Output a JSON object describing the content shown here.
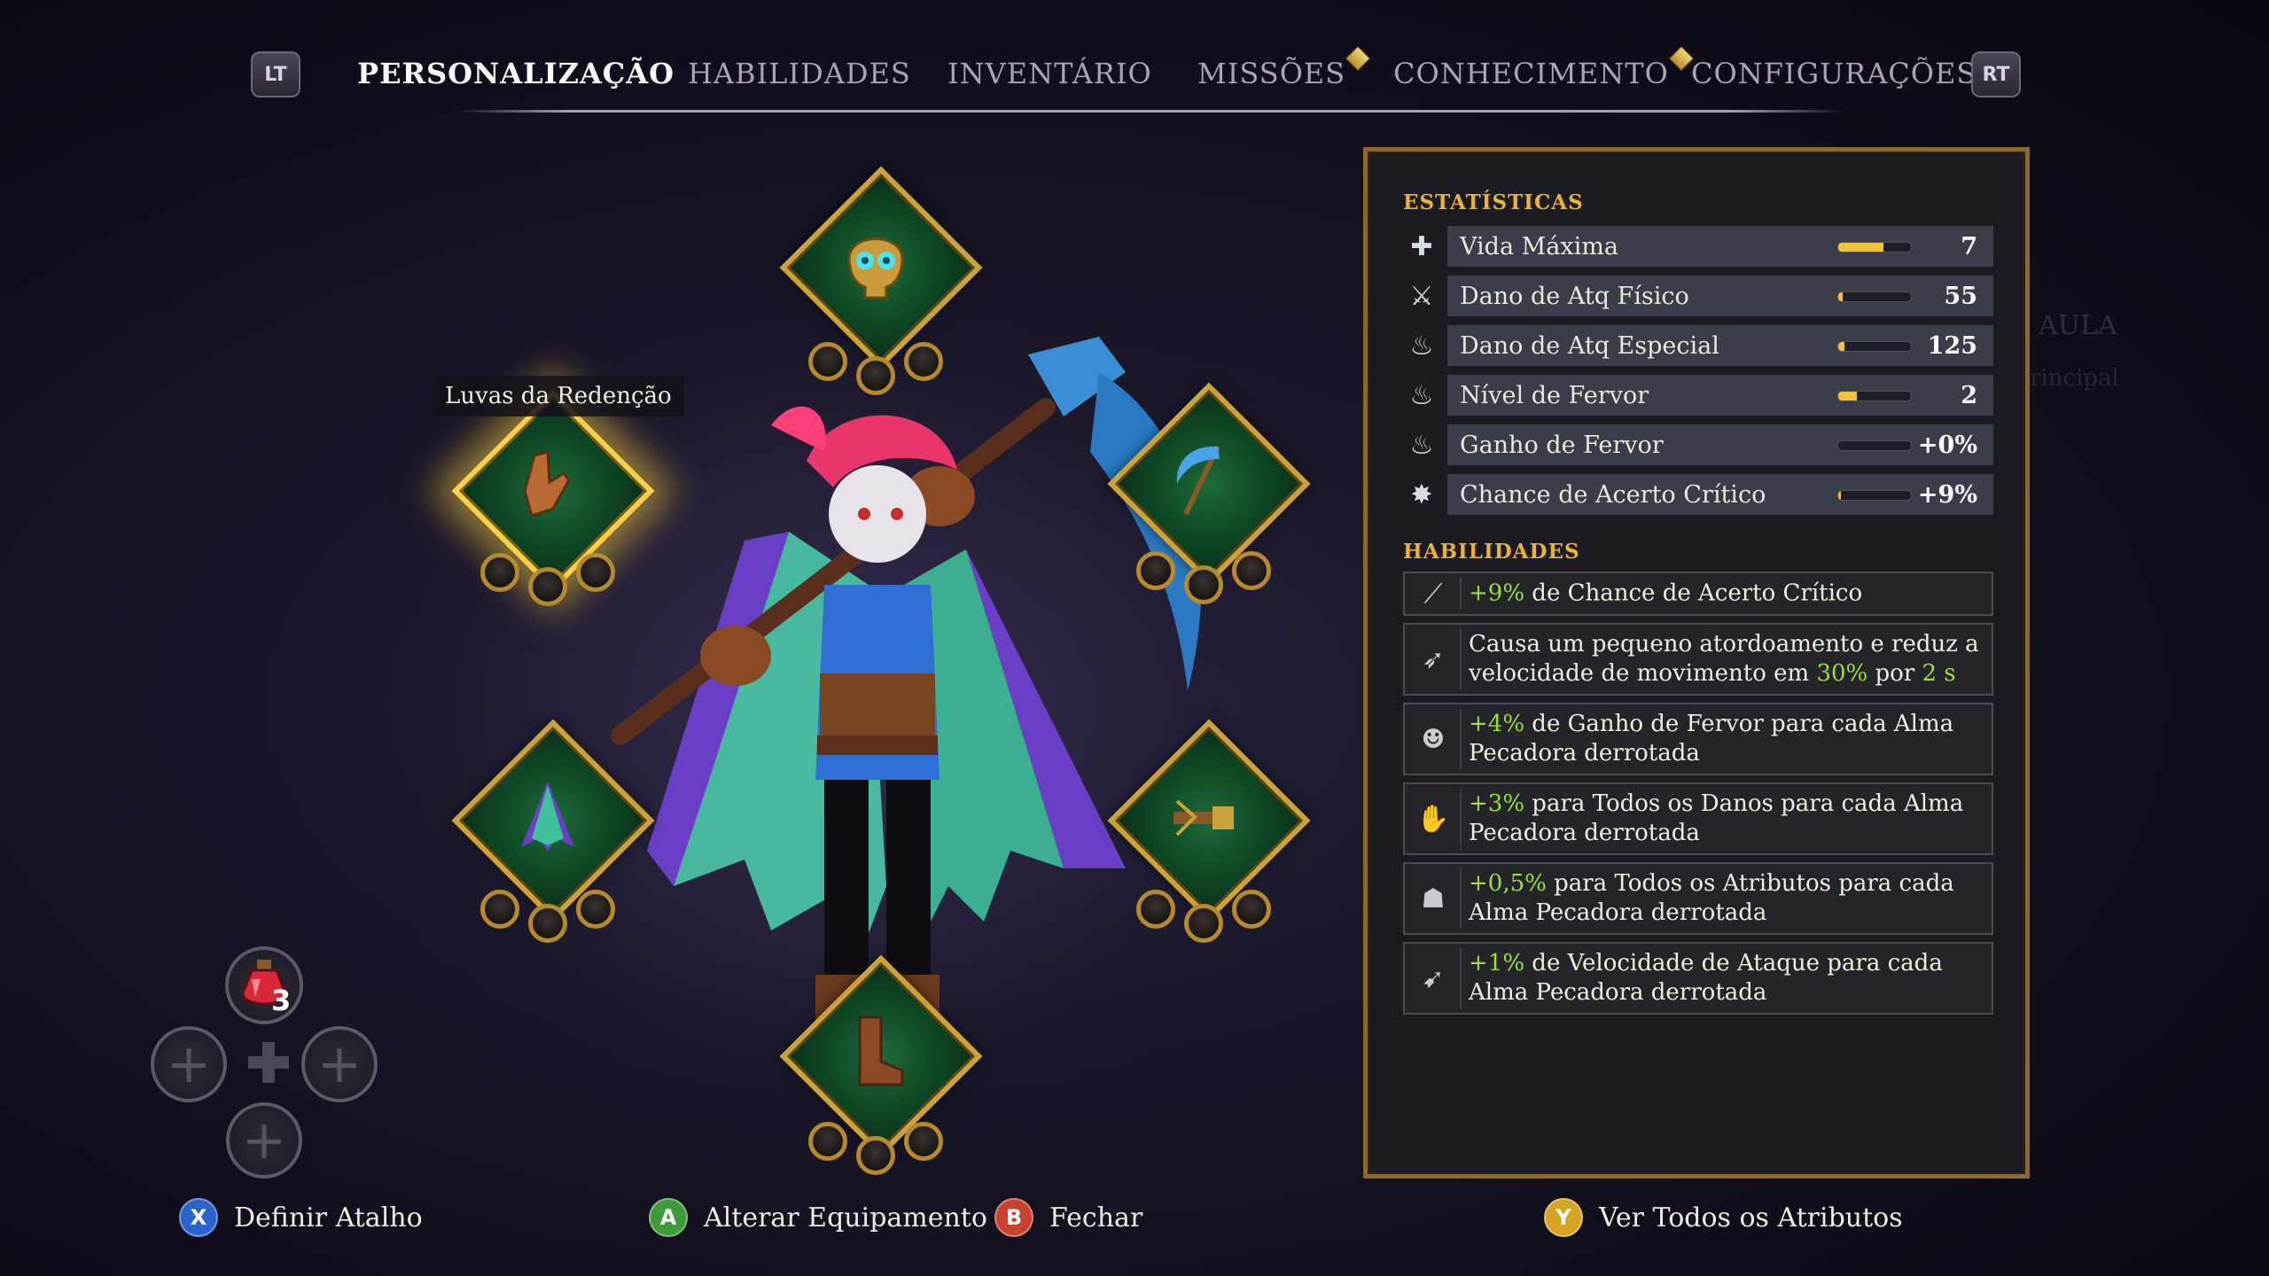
{
  "nav": {
    "left_bumper": "LT",
    "right_bumper": "RT",
    "tabs": [
      {
        "label": "PERSONALIZAÇÃO",
        "active": true
      },
      {
        "label": "HABILIDADES",
        "active": false
      },
      {
        "label": "INVENTÁRIO",
        "active": false
      },
      {
        "label": "MISSÕES",
        "active": false,
        "notification": true
      },
      {
        "label": "CONHECIMENTO",
        "active": false,
        "notification": true
      },
      {
        "label": "CONFIGURAÇÕES",
        "active": false
      }
    ]
  },
  "equipment": {
    "selected_item_name": "Luvas da Redenção",
    "slots": [
      {
        "slot": "head",
        "icon": "golden-skull-mask-icon"
      },
      {
        "slot": "hands",
        "icon": "gloves-icon",
        "selected": true
      },
      {
        "slot": "weapon",
        "icon": "scythe-icon"
      },
      {
        "slot": "cloak",
        "icon": "cloak-icon"
      },
      {
        "slot": "secondary",
        "icon": "crossbow-icon"
      },
      {
        "slot": "boots",
        "icon": "boots-icon"
      }
    ]
  },
  "stats": {
    "title": "ESTATÍSTICAS",
    "rows": [
      {
        "label": "Vida Máxima",
        "value": "7",
        "meter": 0.62,
        "icon": "heart-cross-icon"
      },
      {
        "label": "Dano de Atq Físico",
        "value": "55",
        "meter": 0.06,
        "icon": "crossed-swords-icon"
      },
      {
        "label": "Dano de Atq Especial",
        "value": "125",
        "meter": 0.08,
        "icon": "flame-icon"
      },
      {
        "label": "Nível de Fervor",
        "value": "2",
        "meter": 0.25,
        "icon": "fervor-flame-icon"
      },
      {
        "label": "Ganho de Fervor",
        "value": "+0%",
        "meter": 0.0,
        "icon": "fervor-gain-icon"
      },
      {
        "label": "Chance de Acerto Crítico",
        "value": "+9%",
        "meter": 0.04,
        "icon": "critical-burst-icon"
      }
    ]
  },
  "abilities": {
    "title": "HABILIDADES",
    "rows": [
      {
        "icon": "scythe-slash-icon",
        "highlight": "+9%",
        "text": " de Chance de Acerto Crítico"
      },
      {
        "icon": "stun-arrow-icon",
        "text_a": "Causa um pequeno atordoamento e reduz a velocidade de movimento em ",
        "highlight": "30%",
        "text_b": " por ",
        "highlight2": "2 s"
      },
      {
        "icon": "mask-icon",
        "highlight": "+4%",
        "text": " de Ganho de Fervor para cada Alma Pecadora derrotada"
      },
      {
        "icon": "claw-icon",
        "highlight": "+3%",
        "text": " para Todos os Danos para cada Alma Pecadora derrotada"
      },
      {
        "icon": "cloak-hood-icon",
        "highlight": "+0,5%",
        "text": " para Todos os Atributos para cada Alma Pecadora derrotada"
      },
      {
        "icon": "speed-boot-icon",
        "highlight": "+1%",
        "text": " de Velocidade de Ataque para cada Alma Pecadora derrotada"
      }
    ]
  },
  "quick_slots": {
    "potion_count": "3",
    "potion_icon": "red-potion-icon"
  },
  "prompts": {
    "x": {
      "button": "X",
      "label": "Definir Atalho",
      "color": "#2a63c9"
    },
    "a": {
      "button": "A",
      "label": "Alterar Equipamento",
      "color": "#3f9a3a"
    },
    "b": {
      "button": "B",
      "label": "Fechar",
      "color": "#c7432f"
    },
    "y": {
      "button": "Y",
      "label": "Ver Todos os Atributos",
      "color": "#d6a323"
    }
  },
  "background": {
    "faded_label_1": "AULA",
    "faded_label_2": "rincipal"
  },
  "colors": {
    "accent_gold": "#e8b339",
    "highlight_green": "#9adf3b",
    "panel_border": "#8c6a24"
  }
}
